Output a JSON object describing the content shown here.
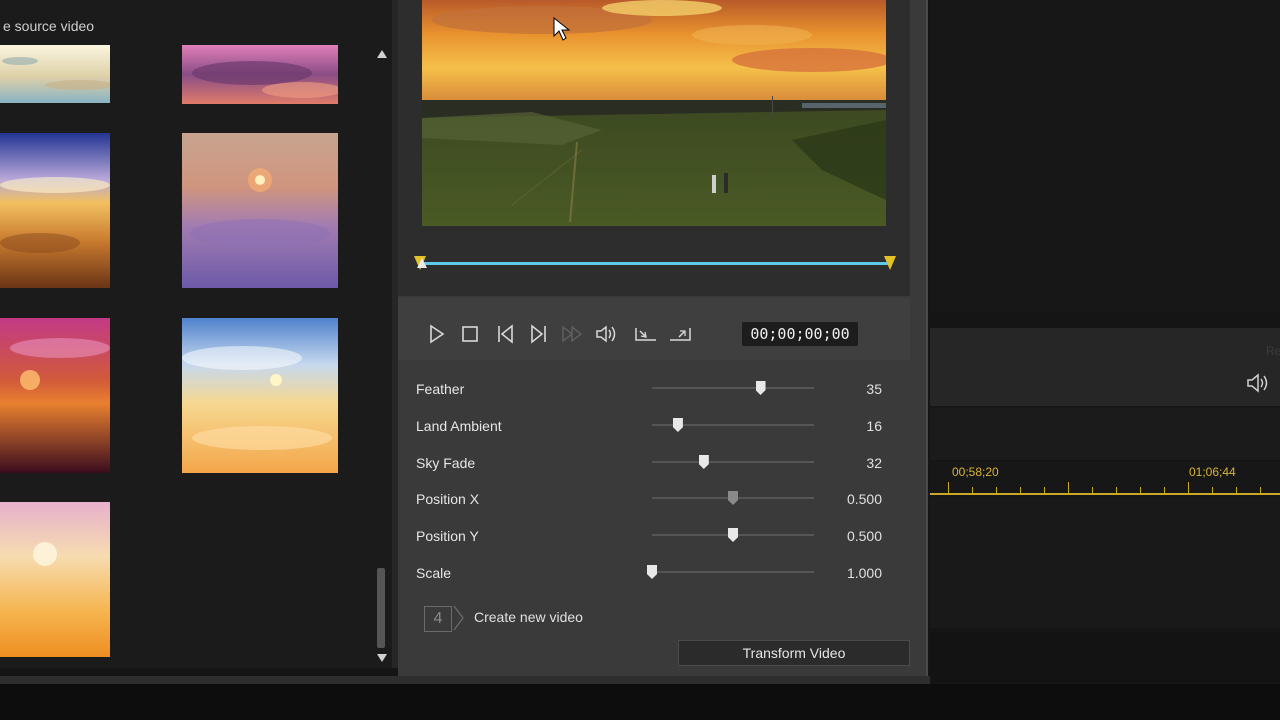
{
  "left_panel": {
    "title": "e source video"
  },
  "thumbnails": [
    {
      "name": "sky-thumb-1",
      "colors": [
        "#f3efd8",
        "#d9c9a2",
        "#8fb8c8"
      ]
    },
    {
      "name": "sky-thumb-2",
      "colors": [
        "#c983a8",
        "#7a4b7a",
        "#d77a6b"
      ]
    },
    {
      "name": "sky-thumb-3",
      "colors": [
        "#2f3a8c",
        "#e8a850",
        "#8a4a22"
      ]
    },
    {
      "name": "sky-thumb-4",
      "colors": [
        "#d0a58a",
        "#a57fb0",
        "#6f5aa8"
      ]
    },
    {
      "name": "sky-thumb-5",
      "colors": [
        "#b8337a",
        "#d8662a",
        "#4a1024"
      ]
    },
    {
      "name": "sky-thumb-6",
      "colors": [
        "#5f8fd0",
        "#f1d28a",
        "#f5b35a"
      ]
    },
    {
      "name": "sky-thumb-7",
      "colors": [
        "#e8b7cc",
        "#f7d49a",
        "#f0a030"
      ]
    }
  ],
  "player": {
    "timecode": "00;00;00;00",
    "controls": [
      "play-icon",
      "stop-icon",
      "prev-frame-icon",
      "next-frame-icon",
      "fast-forward-icon",
      "volume-icon",
      "mark-in-icon",
      "mark-out-icon"
    ]
  },
  "params": [
    {
      "label": "Feather",
      "value": "35",
      "level": 0.67,
      "dim": false
    },
    {
      "label": "Land Ambient",
      "value": "16",
      "level": 0.16,
      "dim": false
    },
    {
      "label": "Sky Fade",
      "value": "32",
      "level": 0.32,
      "dim": false
    },
    {
      "label": "Position X",
      "value": "0.500",
      "level": 0.5,
      "dim": true
    },
    {
      "label": "Position Y",
      "value": "0.500",
      "level": 0.5,
      "dim": false
    },
    {
      "label": "Scale",
      "value": "1.000",
      "level": 0.0,
      "dim": false
    }
  ],
  "step": {
    "number": "4",
    "label": "Create new video"
  },
  "transform_button": "Transform Video",
  "timeline": {
    "labels": [
      "00;58;20",
      "01;06;44"
    ],
    "ghost_text": "Re"
  },
  "colors": {
    "accent_blue": "#5cc8ea",
    "marker_yellow": "#e2c227",
    "ruler_gold": "#caa82a"
  }
}
